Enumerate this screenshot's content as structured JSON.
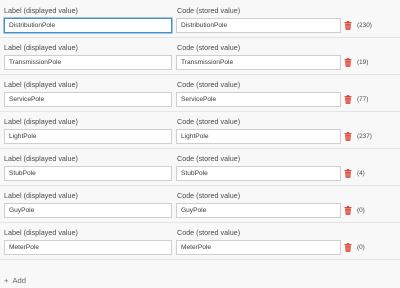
{
  "columns": {
    "label_header": "Label (displayed value)",
    "code_header": "Code (stored value)"
  },
  "rows": [
    {
      "label": "DistributionPole",
      "code": "DistributionPole",
      "count": "(230)"
    },
    {
      "label": "TransmissionPole",
      "code": "TransmissionPole",
      "count": "(19)"
    },
    {
      "label": "ServicePole",
      "code": "ServicePole",
      "count": "(77)"
    },
    {
      "label": "LightPole",
      "code": "LightPole",
      "count": "(237)"
    },
    {
      "label": "StubPole",
      "code": "StubPole",
      "count": "(4)"
    },
    {
      "label": "GuyPole",
      "code": "GuyPole",
      "count": "(0)"
    },
    {
      "label": "MeterPole",
      "code": "MeterPole",
      "count": "(0)"
    }
  ],
  "add_label": "Add",
  "icons": {
    "delete": "trash-icon",
    "add": "plus-icon"
  },
  "colors": {
    "delete_icon": "#d83020",
    "focus_border": "#4a90c8"
  }
}
